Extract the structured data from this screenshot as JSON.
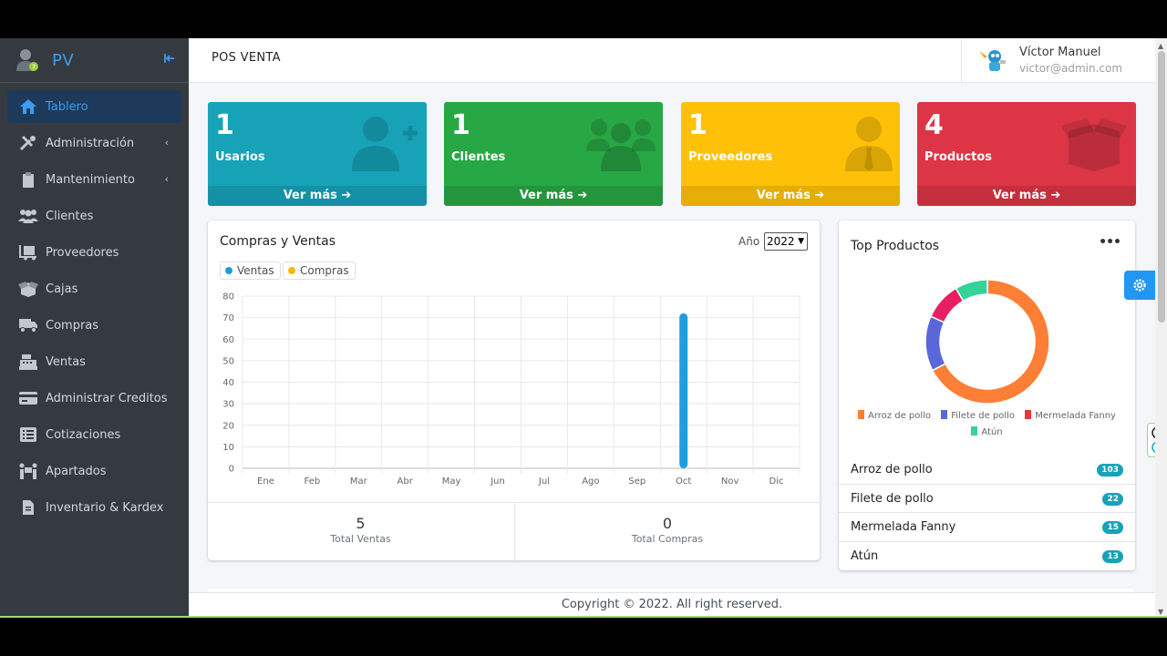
{
  "brand": {
    "name": "PV"
  },
  "sidebar": {
    "items": [
      {
        "label": "Tablero"
      },
      {
        "label": "Administración"
      },
      {
        "label": "Mantenimiento"
      },
      {
        "label": "Clientes"
      },
      {
        "label": "Proveedores"
      },
      {
        "label": "Cajas"
      },
      {
        "label": "Compras"
      },
      {
        "label": "Ventas"
      },
      {
        "label": "Administrar Creditos"
      },
      {
        "label": "Cotizaciones"
      },
      {
        "label": "Apartados"
      },
      {
        "label": "Inventario & Kardex"
      }
    ]
  },
  "header": {
    "title": "POS VENTA",
    "user_name": "Víctor Manuel",
    "user_email": "victor@admin.com"
  },
  "boxes": [
    {
      "value": "1",
      "label": "Usarios",
      "footer": "Ver más",
      "color": "#17a2b8"
    },
    {
      "value": "1",
      "label": "Clientes",
      "footer": "Ver más",
      "color": "#28a745"
    },
    {
      "value": "1",
      "label": "Proveedores",
      "footer": "Ver más",
      "color": "#ffc107"
    },
    {
      "value": "4",
      "label": "Productos",
      "footer": "Ver más",
      "color": "#dc3545"
    }
  ],
  "sales_chart": {
    "title": "Compras y Ventas",
    "year_label": "Año",
    "year_value": "2022",
    "total_ventas": "5",
    "total_ventas_label": "Total Ventas",
    "total_compras": "0",
    "total_compras_label": "Total Compras"
  },
  "top_products": {
    "title": "Top Productos",
    "items": [
      {
        "name": "Arroz de pollo",
        "count": "103"
      },
      {
        "name": "Filete de pollo",
        "count": "22"
      },
      {
        "name": "Mermelada Fanny",
        "count": "15"
      },
      {
        "name": "Atún",
        "count": "13"
      }
    ]
  },
  "footer": {
    "text": "Copyright © 2022. All right reserved."
  },
  "chart_data": [
    {
      "type": "bar",
      "categories": [
        "Ene",
        "Feb",
        "Mar",
        "Abr",
        "May",
        "Jun",
        "Jul",
        "Ago",
        "Sep",
        "Oct",
        "Nov",
        "Dic"
      ],
      "series": [
        {
          "name": "Ventas",
          "color": "#1e9ee0",
          "values": [
            0,
            0,
            0,
            0,
            0,
            0,
            0,
            0,
            0,
            72,
            0,
            0
          ]
        },
        {
          "name": "Compras",
          "color": "#f5b800",
          "values": [
            0,
            0,
            0,
            0,
            0,
            0,
            0,
            0,
            0,
            0,
            0,
            0
          ]
        }
      ],
      "ylim": [
        0,
        80
      ],
      "yticks": [
        0,
        10,
        20,
        30,
        40,
        50,
        60,
        70,
        80
      ],
      "grid": true,
      "legend": "top-left"
    },
    {
      "type": "pie",
      "categories": [
        "Arroz de pollo",
        "Filete de pollo",
        "Mermelada Fanny",
        "Atún"
      ],
      "values": [
        103,
        22,
        15,
        13
      ],
      "colors": [
        "#fd7e35",
        "#5a67d8",
        "#e91e63",
        "#34d399"
      ],
      "legend": "bottom"
    }
  ]
}
